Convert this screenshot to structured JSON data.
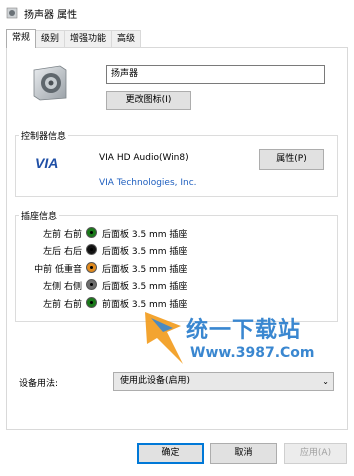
{
  "window": {
    "title": "扬声器 属性"
  },
  "tabs": [
    {
      "label": "常规",
      "active": true
    },
    {
      "label": "级别",
      "active": false
    },
    {
      "label": "增强功能",
      "active": false
    },
    {
      "label": "高级",
      "active": false
    }
  ],
  "device": {
    "name": "扬声器",
    "change_icon_label": "更改图标(I)"
  },
  "controller": {
    "group_title": "控制器信息",
    "name": "VIA HD Audio(Win8)",
    "vendor": "VIA Technologies, Inc.",
    "properties_label": "属性(P)",
    "logo_text": "VIA"
  },
  "jacks": {
    "group_title": "插座信息",
    "rows": [
      {
        "position": "左前 右前",
        "description": "后面板 3.5 mm 插座",
        "color": "#1a7a1a"
      },
      {
        "position": "左后 右后",
        "description": "后面板 3.5 mm 插座",
        "color": "#111111"
      },
      {
        "position": "中前 低重音",
        "description": "后面板 3.5 mm 插座",
        "color": "#e08a1e"
      },
      {
        "position": "左侧 右侧",
        "description": "后面板 3.5 mm 插座",
        "color": "#6d6d6d"
      },
      {
        "position": "左前 右前",
        "description": "前面板 3.5 mm 插座",
        "color": "#1a7a1a"
      }
    ]
  },
  "usage": {
    "label": "设备用法:",
    "selected": "使用此设备(启用)"
  },
  "footer": {
    "ok_label": "确定",
    "cancel_label": "取消",
    "apply_label": "应用(A)"
  },
  "watermark": {
    "line1": "统一下载站",
    "line2": "Www.3987.Com"
  }
}
